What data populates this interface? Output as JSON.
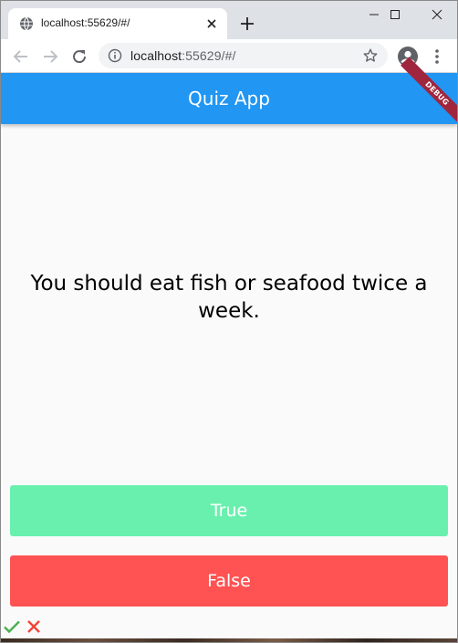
{
  "browser": {
    "tab": {
      "title": "localhost:55629/#/",
      "favicon": "globe-icon"
    },
    "url_host": "localhost",
    "url_rest": ":55629/#/",
    "icons": {
      "back": "arrow-left-icon",
      "forward": "arrow-right-icon",
      "reload": "reload-icon",
      "info": "info-icon",
      "star": "star-icon",
      "profile": "profile-icon",
      "menu": "more-vertical-icon"
    }
  },
  "app": {
    "title": "Quiz App",
    "banner": "DEBUG",
    "colors": {
      "app_bar": "#2196f3",
      "true_button": "#69f0ae",
      "false_button": "#ff5252",
      "check": "#4caf50",
      "cross": "#f44336"
    }
  },
  "quiz": {
    "question": "You should eat fish or seafood twice a week.",
    "true_label": "True",
    "false_label": "False",
    "score_keeper": [
      "check-icon",
      "close-icon"
    ]
  }
}
